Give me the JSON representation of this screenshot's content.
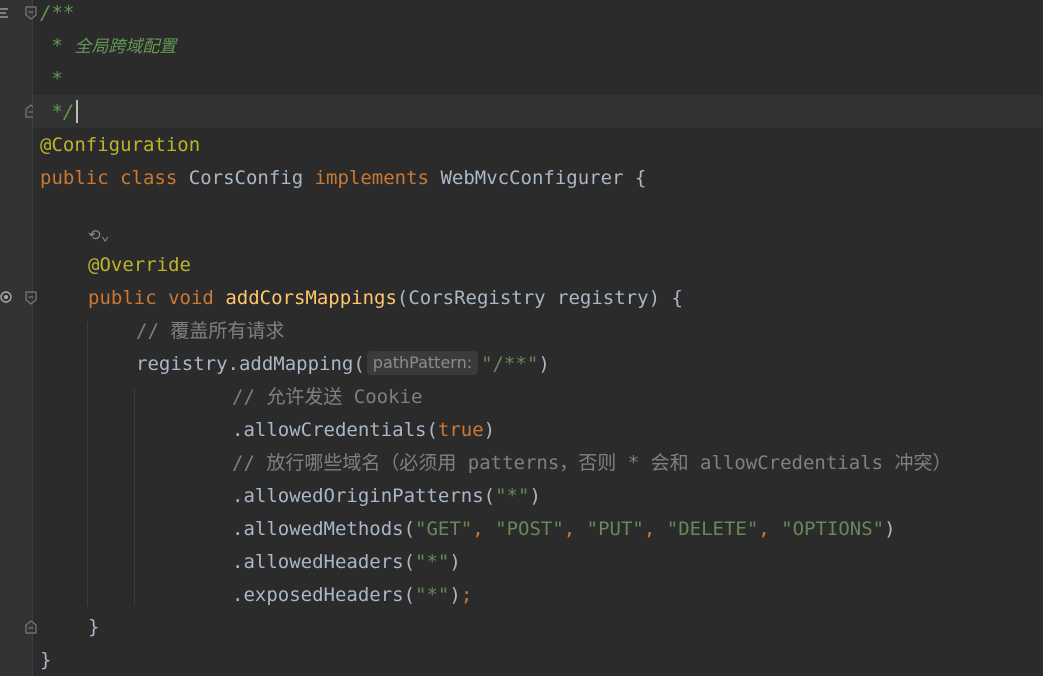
{
  "editor": {
    "doc_comment": {
      "open": "/**",
      "title_star": "*",
      "title_text": "全局跨域配置",
      "blank_star": "*",
      "close": "*/"
    },
    "annotation_class": "@Configuration",
    "class_decl": {
      "kw_public": "public",
      "kw_class": "class",
      "name": "CorsConfig",
      "kw_implements": "implements",
      "iface": "WebMvcConfigurer",
      "brace": "{"
    },
    "code_lens_icon": "⟲⌄",
    "annotation_override": "@Override",
    "method_decl": {
      "kw_public": "public",
      "kw_void": "void",
      "name": "addCorsMappings",
      "params": "(CorsRegistry registry) {"
    },
    "comment_cover": "// 覆盖所有请求",
    "add_mapping": {
      "call": "registry.addMapping(",
      "hint": "pathPattern:",
      "arg": "\"/**\"",
      "close": ")"
    },
    "comment_cookie": "// 允许发送 Cookie",
    "allow_credentials": {
      "call": ".allowCredentials(",
      "arg": "true",
      "close": ")"
    },
    "comment_origins": "// 放行哪些域名（必须用 patterns，否则 * 会和 allowCredentials 冲突）",
    "allowed_origin_patterns": {
      "call": ".allowedOriginPatterns(",
      "arg": "\"*\"",
      "close": ")"
    },
    "allowed_methods": {
      "call": ".allowedMethods(",
      "args": [
        "\"GET\"",
        "\"POST\"",
        "\"PUT\"",
        "\"DELETE\"",
        "\"OPTIONS\""
      ],
      "sep": ", ",
      "close": ")"
    },
    "allowed_headers": {
      "call": ".allowedHeaders(",
      "arg": "\"*\"",
      "close": ")"
    },
    "exposed_headers": {
      "call": ".exposedHeaders(",
      "arg": "\"*\"",
      "close": ")",
      "semi": ";"
    },
    "method_close": "}",
    "class_close": "}"
  },
  "colors": {
    "background": "#2b2b2b",
    "keyword": "#cc7832",
    "string": "#6a8759",
    "doc_comment": "#629755",
    "comment": "#808080",
    "annotation": "#bbb529",
    "function": "#ffc66d",
    "default": "#a9b7c6"
  }
}
